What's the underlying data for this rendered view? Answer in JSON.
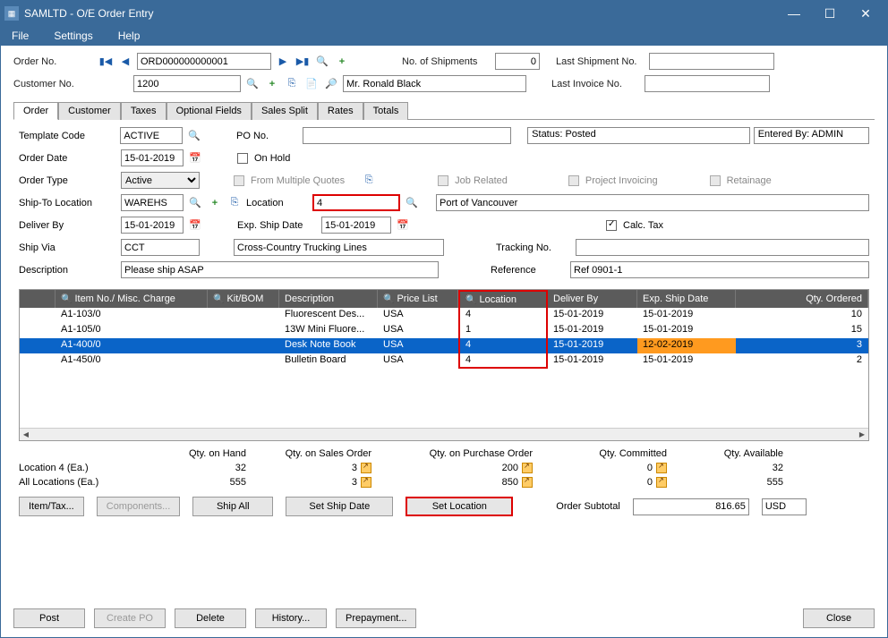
{
  "title": "SAMLTD - O/E Order Entry",
  "menu": {
    "file": "File",
    "settings": "Settings",
    "help": "Help"
  },
  "toprow": {
    "orderno_lbl": "Order No.",
    "orderno_val": "ORD000000000001",
    "shipments_lbl": "No. of Shipments",
    "shipments_val": "0",
    "lastship_lbl": "Last Shipment No.",
    "lastship_val": ""
  },
  "custrow": {
    "custno_lbl": "Customer No.",
    "custno_val": "1200",
    "custname": "Mr. Ronald Black",
    "lastinv_lbl": "Last Invoice No.",
    "lastinv_val": ""
  },
  "tabs": {
    "order": "Order",
    "customer": "Customer",
    "taxes": "Taxes",
    "optional": "Optional Fields",
    "sales": "Sales Split",
    "rates": "Rates",
    "totals": "Totals"
  },
  "form": {
    "template_lbl": "Template Code",
    "template_val": "ACTIVE",
    "pono_lbl": "PO No.",
    "pono_val": "",
    "status_lbl": "Status: Posted",
    "entered_lbl": "Entered By: ADMIN",
    "orderdate_lbl": "Order Date",
    "orderdate_val": "15-01-2019",
    "onhold_lbl": "On Hold",
    "ordertype_lbl": "Order Type",
    "ordertype_val": "Active",
    "frommult_lbl": "From Multiple Quotes",
    "jobrel_lbl": "Job Related",
    "projinv_lbl": "Project Invoicing",
    "retainage_lbl": "Retainage",
    "shipto_lbl": "Ship-To Location",
    "shipto_val": "WAREHS",
    "location_lbl": "Location",
    "location_val": "4",
    "locname": "Port of Vancouver",
    "deliver_lbl": "Deliver By",
    "deliver_val": "15-01-2019",
    "expship_lbl": "Exp. Ship Date",
    "expship_val": "15-01-2019",
    "calctax_lbl": "Calc. Tax",
    "shipvia_lbl": "Ship Via",
    "shipvia_val": "CCT",
    "shipvia_name": "Cross-Country Trucking Lines",
    "tracking_lbl": "Tracking No.",
    "tracking_val": "",
    "desc_lbl": "Description",
    "desc_val": "Please ship ASAP",
    "ref_lbl": "Reference",
    "ref_val": "Ref 0901-1"
  },
  "gridhead": {
    "item": "Item No./ Misc. Charge",
    "kitbom": "Kit/BOM",
    "desc": "Description",
    "price": "Price List",
    "loc": "Location",
    "deliver": "Deliver By",
    "expship": "Exp. Ship Date",
    "qty": "Qty. Ordered"
  },
  "rows": [
    {
      "item": "A1-103/0",
      "kit": "",
      "desc": "Fluorescent Des...",
      "price": "USA",
      "loc": "4",
      "deliver": "15-01-2019",
      "ship": "15-01-2019",
      "qty": "10"
    },
    {
      "item": "A1-105/0",
      "kit": "",
      "desc": "13W Mini Fluore...",
      "price": "USA",
      "loc": "1",
      "deliver": "15-01-2019",
      "ship": "15-01-2019",
      "qty": "15"
    },
    {
      "item": "A1-400/0",
      "kit": "",
      "desc": "Desk Note Book",
      "price": "USA",
      "loc": "4",
      "deliver": "15-01-2019",
      "ship": "12-02-2019",
      "qty": "3",
      "sel": true,
      "shipOrange": true
    },
    {
      "item": "A1-450/0",
      "kit": "",
      "desc": "Bulletin Board",
      "price": "USA",
      "loc": "4",
      "deliver": "15-01-2019",
      "ship": "15-01-2019",
      "qty": "2"
    }
  ],
  "qty": {
    "hdr_onhand": "Qty. on Hand",
    "hdr_sales": "Qty. on Sales Order",
    "hdr_po": "Qty. on Purchase Order",
    "hdr_comm": "Qty. Committed",
    "hdr_avail": "Qty. Available",
    "loc_lbl": "Location  4 (Ea.)",
    "loc_onhand": "32",
    "loc_sales": "3",
    "loc_po": "200",
    "loc_comm": "0",
    "loc_avail": "32",
    "all_lbl": "All Locations (Ea.)",
    "all_onhand": "555",
    "all_sales": "3",
    "all_po": "850",
    "all_comm": "0",
    "all_avail": "555"
  },
  "buttons": {
    "itemtax": "Item/Tax...",
    "components": "Components...",
    "shipall": "Ship All",
    "setshipdate": "Set Ship Date",
    "setlocation": "Set Location",
    "subtotal_lbl": "Order Subtotal",
    "subtotal_val": "816.65",
    "curr": "USD",
    "post": "Post",
    "createpo": "Create PO",
    "delete": "Delete",
    "history": "History...",
    "prepay": "Prepayment...",
    "close": "Close"
  }
}
